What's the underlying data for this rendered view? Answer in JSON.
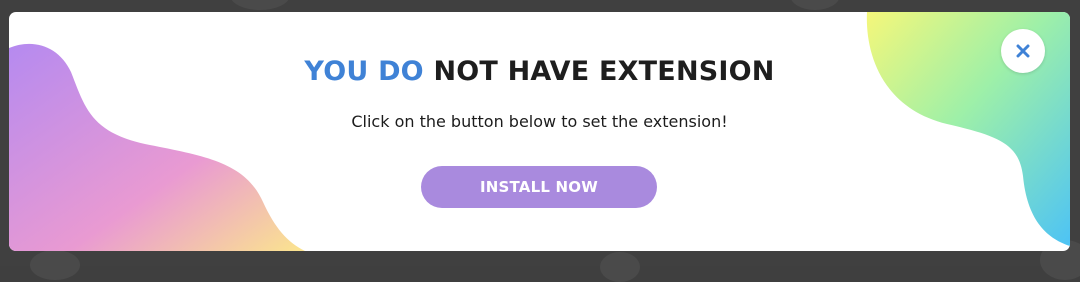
{
  "modal": {
    "title_accent": "YOU DO",
    "title_rest": "NOT HAVE EXTENSION",
    "subtitle": "Click on the button below to set the extension!",
    "install_label": "INSTALL NOW",
    "close_icon": "close-icon"
  },
  "colors": {
    "title_accent": "#3f82d6",
    "button": "#a98ade",
    "close_icon": "#3f82d6",
    "blob_left_top": "#b58af0",
    "blob_left_bottom": "#fbe58e",
    "blob_right_top": "#f5f77a",
    "blob_right_bottom": "#4dc3f5"
  }
}
